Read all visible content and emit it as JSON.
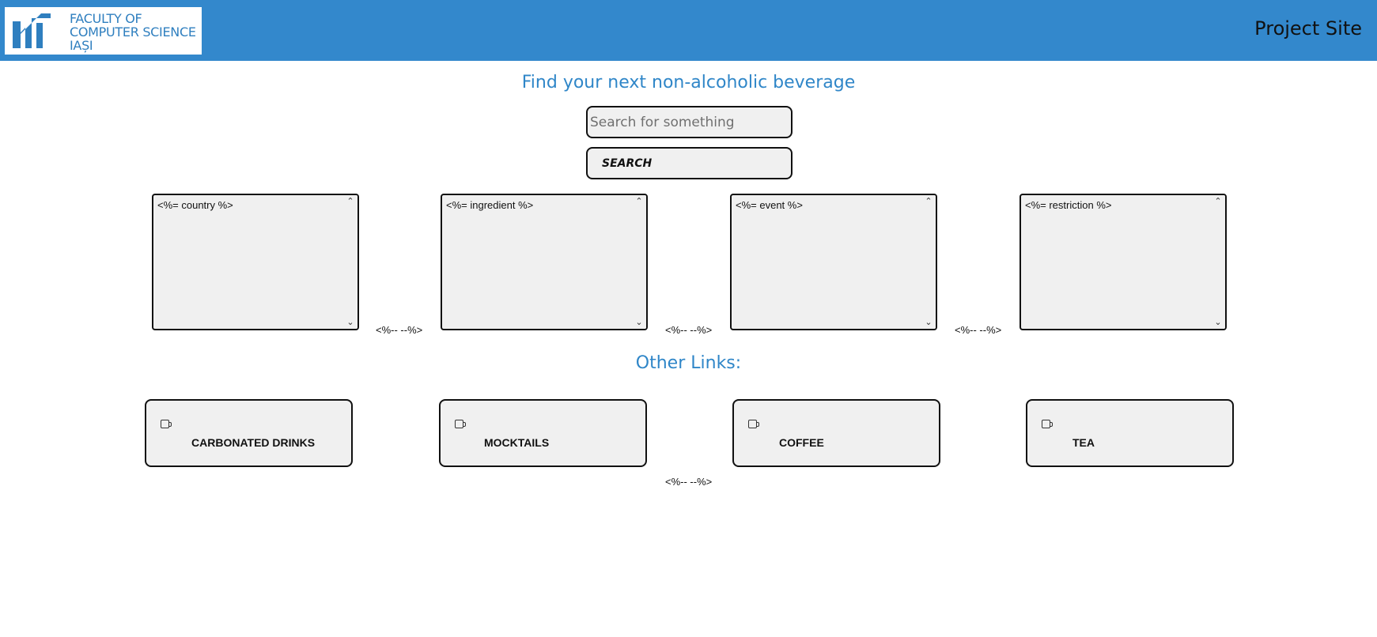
{
  "header": {
    "logo_lines": [
      "FACULTY OF",
      "COMPUTER SCIENCE",
      "IAȘI"
    ],
    "site_title": "Project Site",
    "background_color": "#3388cc"
  },
  "main": {
    "heading": "Find your next non-alcoholic beverage",
    "search": {
      "placeholder": "Search for something",
      "value": "",
      "button_label": "SEARCH"
    },
    "filters": [
      {
        "text": "<%= country %>"
      },
      {
        "text": "<%= ingredient %>"
      },
      {
        "text": "<%= event %>"
      },
      {
        "text": "<%= restriction %>"
      }
    ],
    "filter_separators": [
      "<%-- --%>",
      "<%-- --%>",
      "<%-- --%>"
    ],
    "other_links_heading": "Other Links:",
    "links": [
      {
        "label": "CARBONATED DRINKS",
        "icon": "mug-icon"
      },
      {
        "label": "MOCKTAILS",
        "icon": "mug-icon"
      },
      {
        "label": "COFFEE",
        "icon": "mug-icon"
      },
      {
        "label": "TEA",
        "icon": "mug-icon"
      }
    ],
    "links_footer_comment": "<%-- --%>"
  }
}
